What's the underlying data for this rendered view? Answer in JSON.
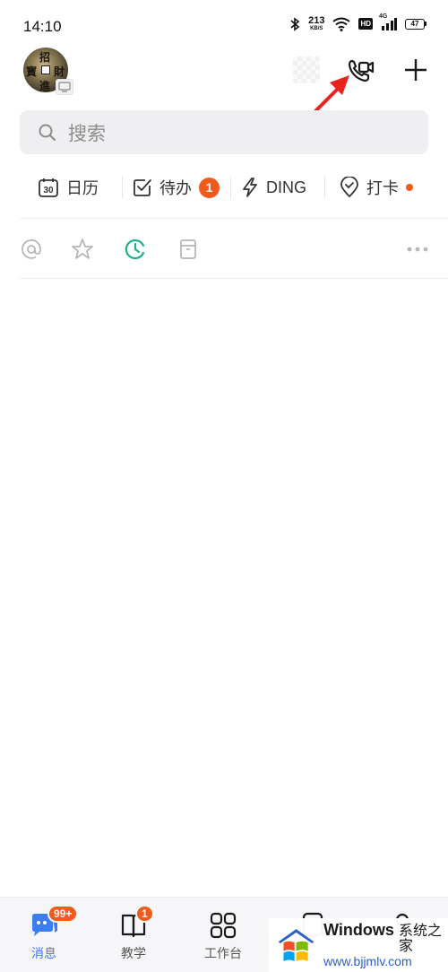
{
  "status_bar": {
    "time": "14:10",
    "net_speed": "213",
    "net_unit": "KB/S",
    "hd": "HD",
    "net_type": "4G",
    "battery": "47"
  },
  "header": {
    "avatar_chars": [
      "招",
      "寳",
      "財",
      "進"
    ],
    "icons": [
      "device-icon",
      "video-call-icon",
      "add-icon"
    ]
  },
  "search": {
    "placeholder": "搜索",
    "icon": "search-icon"
  },
  "shortcuts": [
    {
      "label": "日历",
      "icon": "calendar-icon",
      "icon_text": "30"
    },
    {
      "label": "待办",
      "icon": "todo-check-icon",
      "badge": "1"
    },
    {
      "label": "DING",
      "icon": "lightning-icon"
    },
    {
      "label": "打卡",
      "icon": "location-pin-icon",
      "dot": true
    }
  ],
  "filters": [
    "at-icon",
    "star-icon",
    "clock-icon",
    "archive-icon",
    "more-icon"
  ],
  "tabs": [
    {
      "label": "消息",
      "icon": "message-icon",
      "badge": "99+",
      "active": true
    },
    {
      "label": "教学",
      "icon": "book-icon",
      "badge": "1"
    },
    {
      "label": "工作台",
      "icon": "grid-icon"
    },
    {
      "label": "",
      "icon": "contacts-icon"
    },
    {
      "label": "",
      "icon": "profile-icon"
    }
  ],
  "watermark": {
    "brand": "Windows",
    "cn": "系统之家",
    "url": "www.bjjmlv.com"
  },
  "colors": {
    "accent": "#3c7cf4",
    "badge": "#f25a1c",
    "teal": "#1db38a",
    "annotation": "#e8231e"
  }
}
